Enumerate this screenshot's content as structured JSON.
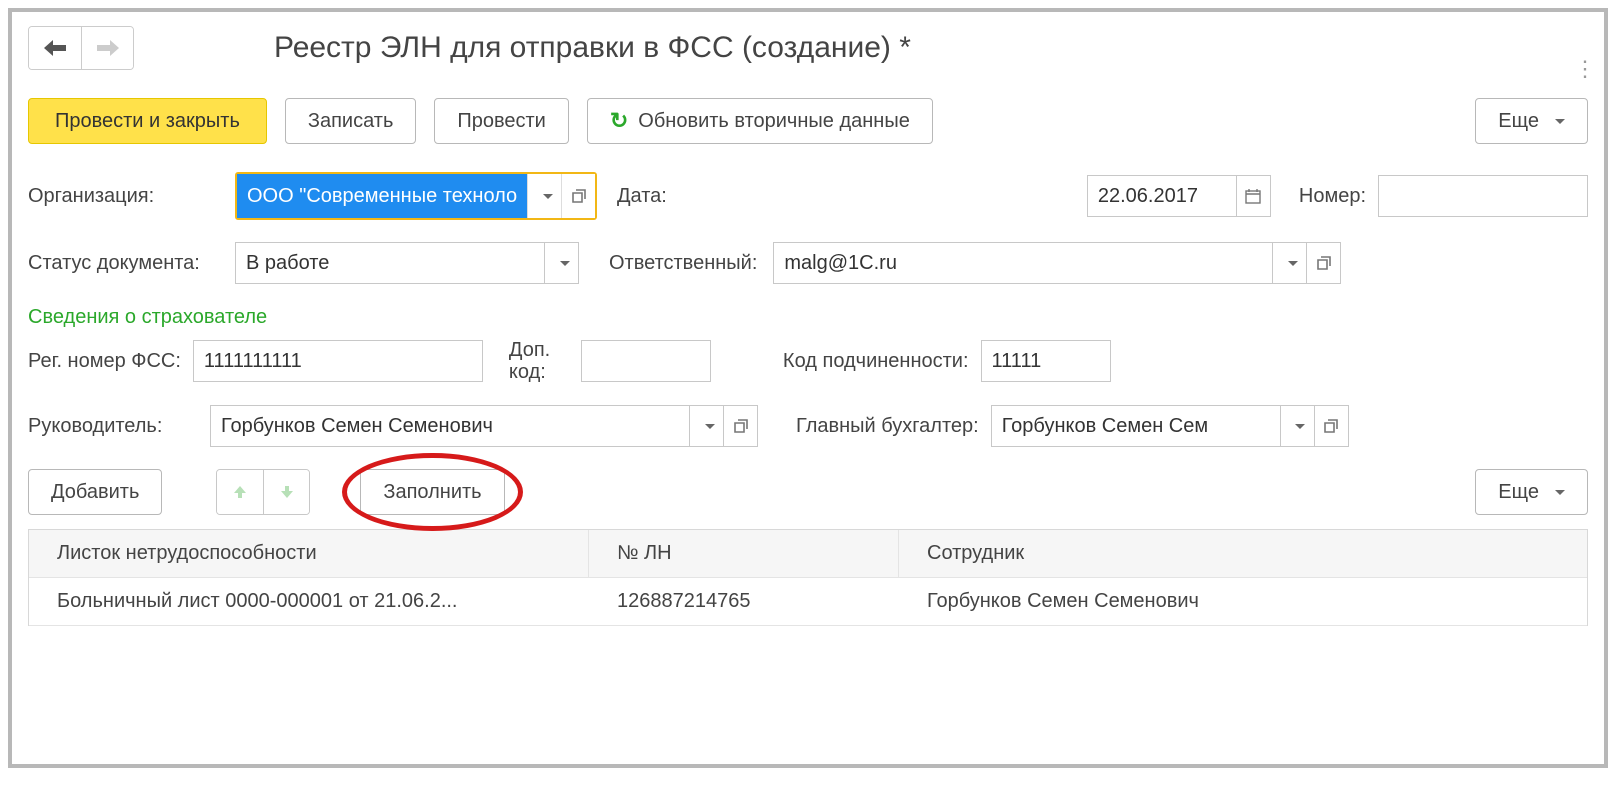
{
  "header": {
    "title": "Реестр ЭЛН для отправки в ФСС (создание) *"
  },
  "toolbar": {
    "post_close": "Провести и закрыть",
    "save": "Записать",
    "post": "Провести",
    "refresh": "Обновить вторичные данные",
    "more": "Еще"
  },
  "form": {
    "org_label": "Организация:",
    "org_value": "ООО \"Современные технологии\"",
    "date_label": "Дата:",
    "date_value": "22.06.2017",
    "number_label": "Номер:",
    "number_value": "",
    "status_label": "Статус документа:",
    "status_value": "В работе",
    "responsible_label": "Ответственный:",
    "responsible_value": "malg@1C.ru"
  },
  "insurer": {
    "section_title": "Сведения о страхователе",
    "reg_label": "Рег. номер ФСС:",
    "reg_value": "1111111111",
    "dop_label": "Доп. код:",
    "dop_value": "",
    "subord_label": "Код подчиненности:",
    "subord_value": "11111",
    "head_label": "Руководитель:",
    "head_value": "Горбунков Семен Семенович",
    "accountant_label": "Главный бухгалтер:",
    "accountant_value": "Горбунков Семен Сем"
  },
  "subtoolbar": {
    "add": "Добавить",
    "fill": "Заполнить",
    "more": "Еще"
  },
  "table": {
    "columns": {
      "sheet": "Листок нетрудоспособности",
      "ln_no": "№ ЛН",
      "employee": "Сотрудник"
    },
    "rows": [
      {
        "sheet": "Больничный лист 0000-000001 от 21.06.2...",
        "ln_no": "126887214765",
        "employee": "Горбунков Семен Семенович"
      }
    ]
  }
}
